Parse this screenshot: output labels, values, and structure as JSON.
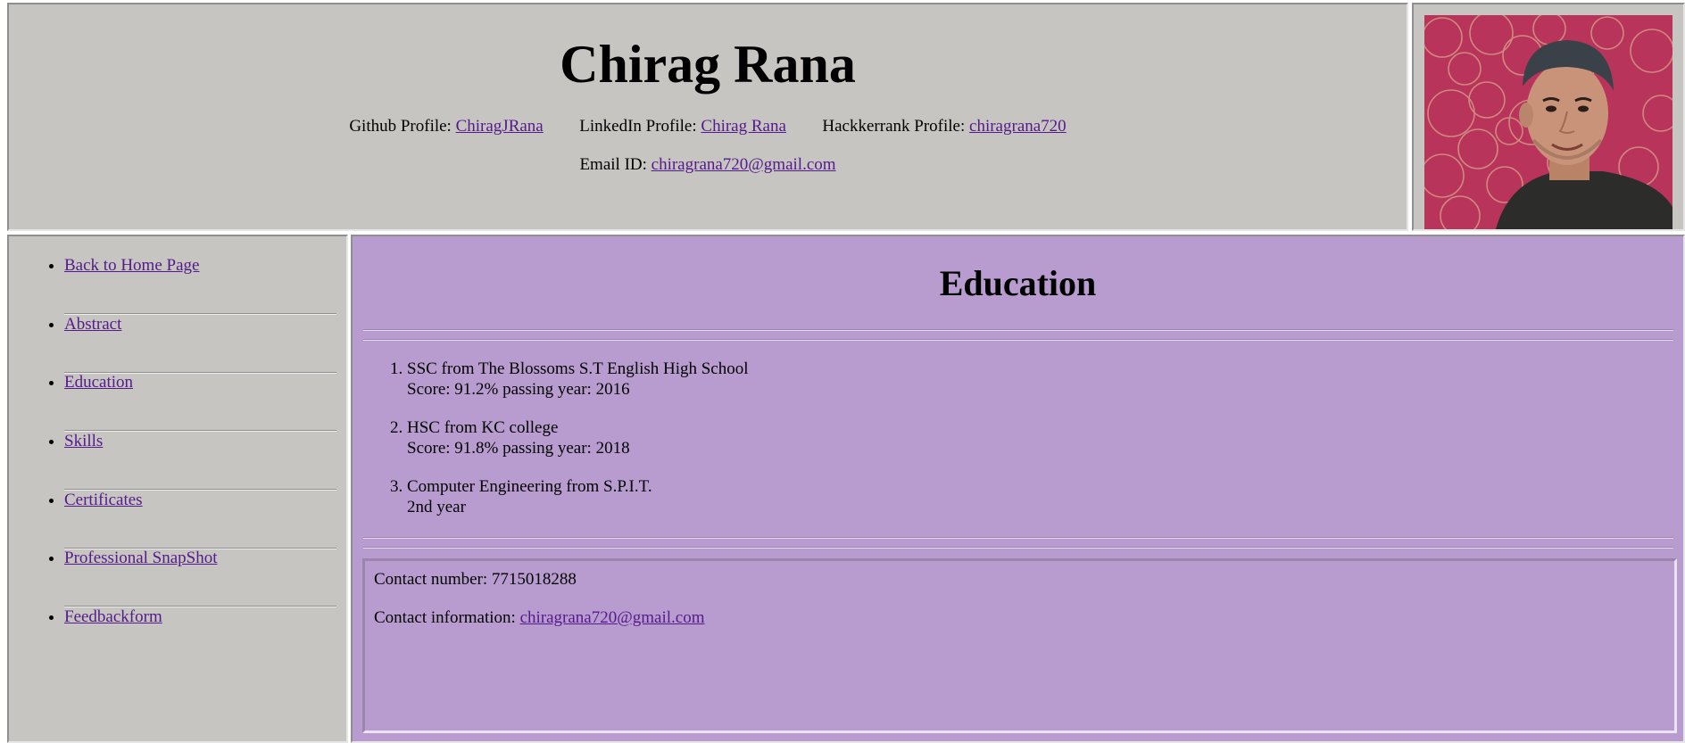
{
  "header": {
    "title": "Chirag Rana",
    "github_label": "Github Profile:",
    "github_link": "ChiragJRana",
    "linkedin_label": "LinkedIn Profile:",
    "linkedin_link": "Chirag Rana",
    "hackerrank_label": "Hackkerrank Profile:",
    "hackerrank_link": "chiragrana720",
    "email_label": "Email ID:",
    "email_link": "chiragrana720@gmail.com"
  },
  "sidebar": {
    "items": [
      {
        "label": "Back to Home Page"
      },
      {
        "label": "Abstract"
      },
      {
        "label": "Education"
      },
      {
        "label": "Skills"
      },
      {
        "label": "Certificates"
      },
      {
        "label": "Professional SnapShot"
      },
      {
        "label": "Feedbackform"
      }
    ]
  },
  "main": {
    "title": "Education",
    "education": [
      {
        "line1": "SSC from The Blossoms S.T English High School",
        "line2": "Score: 91.2% passing year: 2016"
      },
      {
        "line1": "HSC from KC college",
        "line2": "Score: 91.8% passing year: 2018"
      },
      {
        "line1": "Computer Engineering from S.P.I.T.",
        "line2": "2nd year"
      }
    ]
  },
  "contact": {
    "number_label": "Contact number: 7715018288",
    "info_label": "Contact information:",
    "info_link": "chiragrana720@gmail.com"
  },
  "colors": {
    "header_bg": "#c6c5c1",
    "main_bg": "#b99ccf",
    "link": "#551a8b"
  }
}
